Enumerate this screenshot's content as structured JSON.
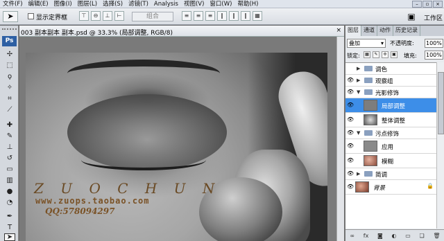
{
  "menu": [
    "文件(F)",
    "编辑(E)",
    "图像(I)",
    "图层(L)",
    "选择(S)",
    "滤镜(T)",
    "Analysis",
    "视图(V)",
    "窗口(W)",
    "帮助(H)"
  ],
  "options": {
    "show_bounds_label": "显示定界框",
    "combine_label": "组合",
    "workspace_label": "工作区"
  },
  "document": {
    "title": "003 副本副本 副本.psd @ 33.3% (局部调整, RGB/8)",
    "watermark_name": "Z U O C H U N",
    "watermark_url": "www.zuops.taobao.com",
    "watermark_qq": "QQ:578094297"
  },
  "tools": {
    "app_badge": "Ps"
  },
  "panel": {
    "tabs": [
      "图层",
      "通道",
      "动作",
      "历史记录"
    ],
    "blend_mode": "叠加",
    "opacity_label": "不透明度:",
    "opacity_value": "100%",
    "lock_label": "锁定:",
    "fill_label": "填充:",
    "fill_value": "100%",
    "layers": [
      {
        "name": "调色",
        "type": "group",
        "visible": false,
        "expanded": false,
        "indent": 0
      },
      {
        "name": "观察组",
        "type": "group",
        "visible": true,
        "expanded": false,
        "indent": 0
      },
      {
        "name": "光影修饰",
        "type": "group",
        "visible": true,
        "expanded": true,
        "indent": 0
      },
      {
        "name": "局部调整",
        "type": "layer",
        "visible": true,
        "indent": 1,
        "selected": true
      },
      {
        "name": "整体调整",
        "type": "layer",
        "visible": true,
        "indent": 1
      },
      {
        "name": "污点修饰",
        "type": "group",
        "visible": true,
        "expanded": true,
        "indent": 0
      },
      {
        "name": "应用",
        "type": "layer",
        "visible": true,
        "indent": 1
      },
      {
        "name": "模糊",
        "type": "layer",
        "visible": true,
        "indent": 1
      },
      {
        "name": "简调",
        "type": "group",
        "visible": true,
        "expanded": false,
        "indent": 0
      },
      {
        "name": "背景",
        "type": "layer",
        "visible": true,
        "indent": 0
      }
    ]
  },
  "colors": {
    "selection": "#3d8ee8",
    "ps_badge": "#2d5fa3",
    "watermark": "#7a5226"
  }
}
